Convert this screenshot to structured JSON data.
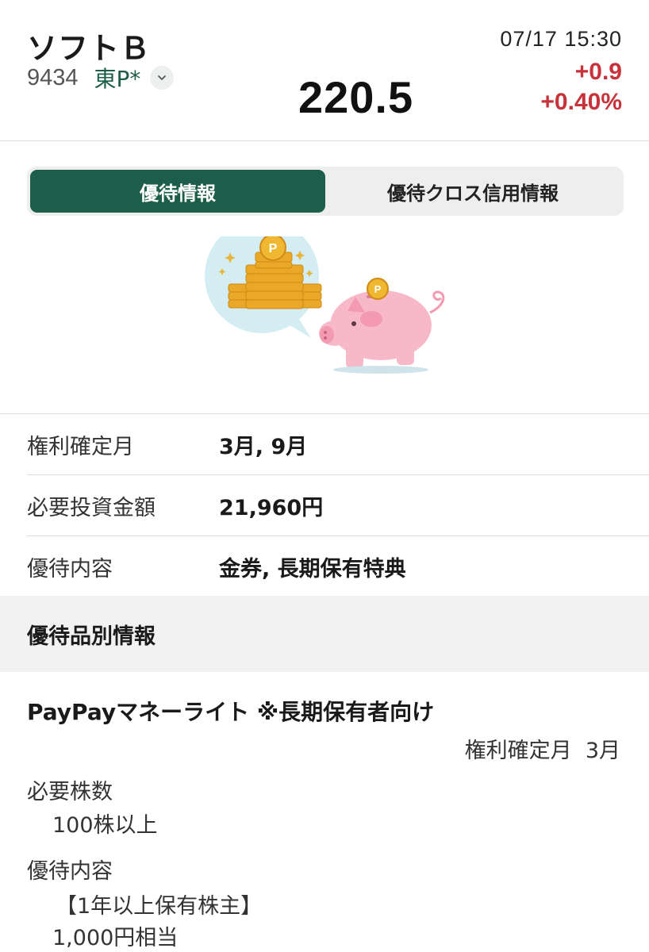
{
  "header": {
    "stock_name": "ソフトＢ",
    "code": "9434",
    "market": "東P*",
    "price": "220.5",
    "datetime": "07/17 15:30",
    "change": "+0.9",
    "change_pct": "+0.40%"
  },
  "tabs": [
    {
      "label": "優待情報",
      "active": true
    },
    {
      "label": "優待クロス信用情報",
      "active": false
    }
  ],
  "info": [
    {
      "label": "権利確定月",
      "value": "3月, 9月"
    },
    {
      "label": "必要投資金額",
      "value": "21,960円"
    },
    {
      "label": "優待内容",
      "value": "金券, 長期保有特典"
    }
  ],
  "section": {
    "title": "優待品別情報"
  },
  "item": {
    "title": "PayPayマネーライト ※長期保有者向け",
    "record_month": "権利確定月  3月",
    "required_shares_label": "必要株数",
    "required_shares_value": "100株以上",
    "benefit_label": "優待内容",
    "benefit_condition": "【1年以上保有株主】",
    "benefit_value": "1,000円相当"
  },
  "colors": {
    "brand_green": "#1d5e4b",
    "up_red": "#c8323a"
  },
  "icons": [
    "chevron-down-icon",
    "piggy-bank-illustration"
  ]
}
